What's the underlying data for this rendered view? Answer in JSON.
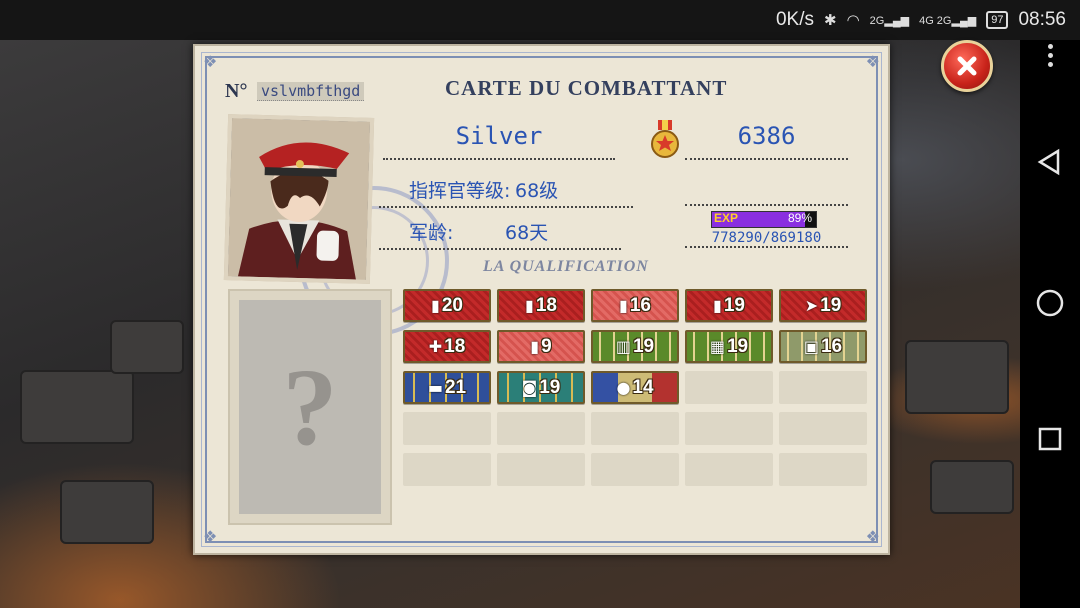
{
  "status_bar": {
    "net_speed": "0K/s",
    "bluetooth_icon": "bluetooth-icon",
    "wifi_icon": "wifi-icon",
    "signal_1": "2G",
    "signal_2": "4G 2G",
    "battery": "97",
    "time": "08:56"
  },
  "card": {
    "serial_label": "N°",
    "serial_value": "vslvmbfthgd",
    "title": "CARTE DU COMBATTANT",
    "player_name": "Silver",
    "score": "6386",
    "rank_label": "指挥官等级:",
    "rank_value": "68级",
    "service_label": "军龄:",
    "service_value": "68天",
    "exp": {
      "label": "EXP",
      "percent_text": "89%",
      "fraction": 0.89,
      "current_total": "778290/869180"
    },
    "section_title": "LA QUALIFICATION",
    "unknown_mark": "?",
    "badges": [
      {
        "icon": "bullet-icon",
        "level": "20",
        "style": "red"
      },
      {
        "icon": "shell-icon",
        "level": "18",
        "style": "red"
      },
      {
        "icon": "cannon-shell-icon",
        "level": "16",
        "style": "pink"
      },
      {
        "icon": "rifle-round-icon",
        "level": "19",
        "style": "red"
      },
      {
        "icon": "rocket-icon",
        "level": "19",
        "style": "red"
      },
      {
        "icon": "syringe-icon",
        "level": "18",
        "style": "red"
      },
      {
        "icon": "battery-icon",
        "level": "9",
        "style": "pink"
      },
      {
        "icon": "door-icon",
        "level": "19",
        "style": "green"
      },
      {
        "icon": "window-icon",
        "level": "19",
        "style": "green"
      },
      {
        "icon": "crate-icon",
        "level": "16",
        "style": "gray"
      },
      {
        "icon": "tank-icon",
        "level": "21",
        "style": "blue"
      },
      {
        "icon": "radio-icon",
        "level": "19",
        "style": "teal"
      },
      {
        "icon": "lightbulb-icon",
        "level": "14",
        "style": "mixed"
      }
    ],
    "empty_slots": 12
  },
  "navbar": {
    "back_icon": "back-triangle-icon",
    "home_icon": "home-circle-icon",
    "recents_icon": "recents-square-icon",
    "menu_icon": "overflow-menu-icon"
  },
  "close_icon": "close-icon"
}
